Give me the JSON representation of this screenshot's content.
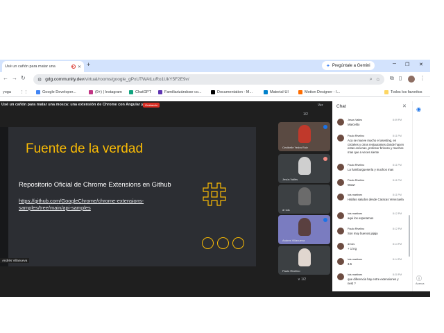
{
  "browser": {
    "tab_title": "Usé un cañón para matar una",
    "new_tab": "+",
    "gemini_button": "Pregúntale a Gemini",
    "url_host": "gdg.community.dev",
    "url_path": "/virtual/rooms/google_gPxUTWAtLuRo1UkY5F2E9v/",
    "bookmarks": [
      {
        "label": "yoga",
        "color": "#ffffff"
      },
      {
        "label": "Google Developer...",
        "color": "#4285f4"
      },
      {
        "label": "(9+) | Instagram",
        "color": "#c13584"
      },
      {
        "label": "ChatGPT",
        "color": "#10a37f"
      },
      {
        "label": "Familiarizándose co...",
        "color": "#5e35b1"
      },
      {
        "label": "Documentation - M...",
        "color": "#000000"
      },
      {
        "label": "Material-UI",
        "color": "#0081cb"
      },
      {
        "label": "Motion Designer - I...",
        "color": "#ff6d00"
      }
    ],
    "all_bookmarks": "Todos los favoritos"
  },
  "meet": {
    "title": "Usé un cañón para matar una mosca: una extensión de Chrome con Angular y Nx",
    "badge": "Grabando",
    "top_right": "Ver",
    "page_count": "1/2",
    "page_count_bottom": "1/2",
    "presenter_label": "Andrés Villanueva",
    "slide": {
      "title": "Fuente de la verdad",
      "subtitle": "Repositorio Oficial de Chrome Extensions en Github",
      "link": "https://github.com/GoogleChrome/chrome-extensions-samples/tree/main/api-samples",
      "accent": "#fbbc04"
    },
    "participants": [
      {
        "name": "Cecibelle Yedra Ruiz",
        "tile_color": "#5a4a42",
        "face_color": "#c0392b"
      },
      {
        "name": "Jesús Vallés",
        "tile_color": "#3c4043",
        "face_color": "#cfcfcf"
      },
      {
        "name": "dr luis",
        "tile_color": "#3c4043",
        "face_color": "#6b6b6b"
      },
      {
        "name": "Andres Villanueva",
        "tile_color": "#7a7cc0",
        "face_color": "#5a4040"
      },
      {
        "name": "Paulo Rivelino",
        "tile_color": "#3c4043",
        "face_color": "#e0d6cf"
      }
    ]
  },
  "chat": {
    "title": "Chat",
    "messages": [
      {
        "name": "Jesus Valles",
        "time": "8:09 PM",
        "text": "Marcelito"
      },
      {
        "name": "Paulo Rivelino",
        "time": "8:11 PM",
        "text": "Aca se mueve mucho el asesting, en cócteles y otros restaurantes donde hacen estas escenas, profesor brincan y muchos mas que a veces siente"
      },
      {
        "name": "Paulo Rivelino",
        "time": "8:11 PM",
        "text": "La hamburguesería y muchos mas"
      },
      {
        "name": "Paulo Rivelino",
        "time": "8:11 PM",
        "text": "Wow!"
      },
      {
        "name": "luis martinez",
        "time": "8:11 PM",
        "text": "Hablas saludos desde Caracas Venezuela"
      },
      {
        "name": "luis martinez",
        "time": "8:12 PM",
        "text": "aqui los esperamos"
      },
      {
        "name": "Paulo Rivelino",
        "time": "8:12 PM",
        "text": "Son muy buenos jajaja"
      },
      {
        "name": "dr luis",
        "time": "8:14 PM",
        "text": "+ 1 ing"
      },
      {
        "name": "luis martinez",
        "time": "8:14 PM",
        "text": "3.5"
      },
      {
        "name": "luis martinez",
        "time": "8:20 PM",
        "text": "que diferencia hay entre extensiones y nest ?"
      }
    ]
  },
  "rail": {
    "label": "Acerca"
  }
}
